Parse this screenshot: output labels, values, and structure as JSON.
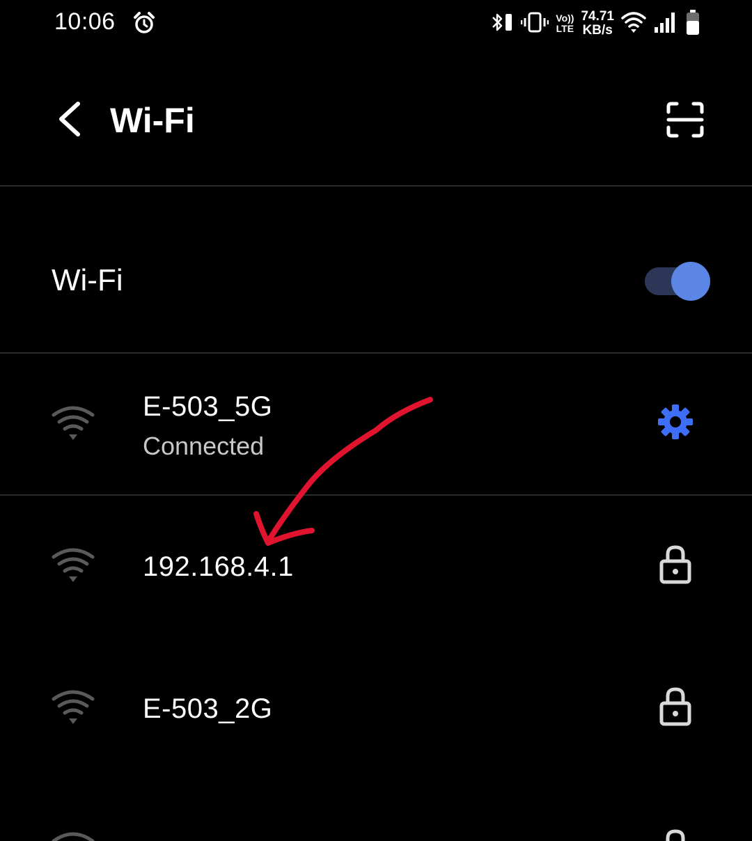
{
  "status_bar": {
    "time": "10:06",
    "volte_top": "Vo))",
    "volte_bottom": "LTE",
    "net_speed_value": "74.71",
    "net_speed_unit": "KB/s",
    "icons": [
      "alarm-icon",
      "bluetooth-icon",
      "vibrate-icon",
      "volte-icon",
      "wifi-status-icon",
      "cellular-signal-icon",
      "battery-icon"
    ]
  },
  "toolbar": {
    "back_icon": "back-arrow-icon",
    "title": "Wi-Fi",
    "scan_icon": "qr-scan-icon"
  },
  "wifi_toggle": {
    "label": "Wi-Fi",
    "enabled": true,
    "accent_color": "#5b86e5"
  },
  "networks": [
    {
      "name": "E-503_5G",
      "status": "Connected",
      "action_icon": "settings-gear-icon",
      "action_color": "#3d6ef5"
    },
    {
      "name": "192.168.4.1",
      "status": "",
      "action_icon": "lock-icon"
    },
    {
      "name": "E-503_2G",
      "status": "",
      "action_icon": "lock-icon"
    }
  ],
  "annotation": {
    "type": "hand-drawn-arrow",
    "color": "#e0142e"
  }
}
